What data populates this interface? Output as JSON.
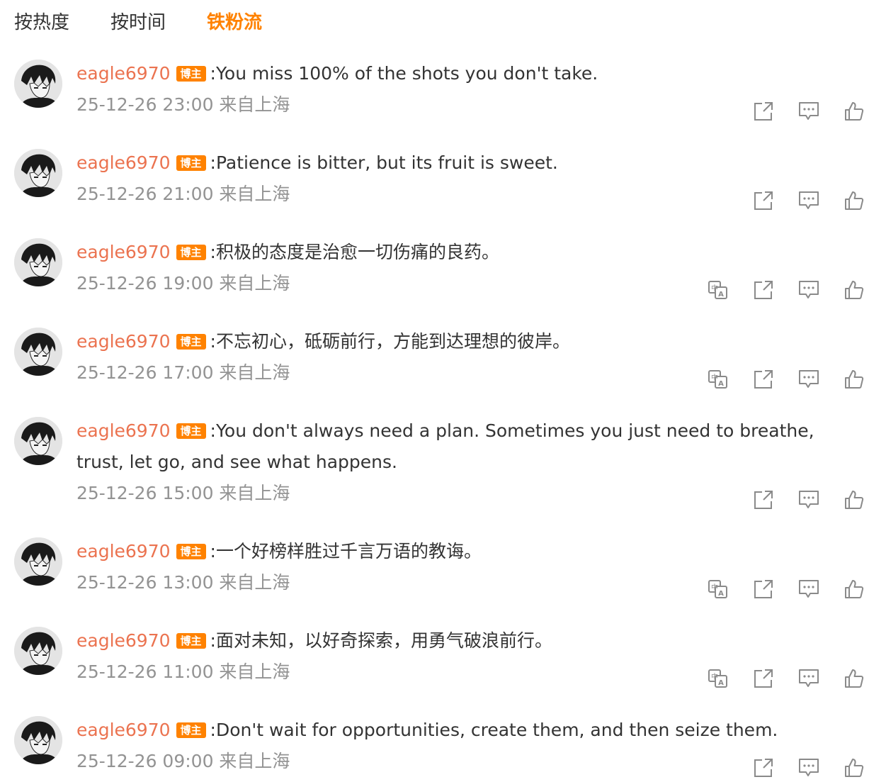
{
  "tabs": [
    {
      "label": "按热度",
      "active": false
    },
    {
      "label": "按时间",
      "active": false
    },
    {
      "label": "铁粉流",
      "active": true
    }
  ],
  "badge_label": "博主",
  "icons": {
    "translate": "translate-icon",
    "repost": "repost-icon",
    "comment": "comment-icon",
    "like": "like-icon"
  },
  "accent_color": "#ff8200",
  "name_color": "#eb7350",
  "comments": [
    {
      "user": "eagle6970",
      "text": ":You miss 100% of the shots you don't take.",
      "time": "25-12-26 23:00 来自上海",
      "translate": false
    },
    {
      "user": "eagle6970",
      "text": ":Patience is bitter, but its fruit is sweet.",
      "time": "25-12-26 21:00 来自上海",
      "translate": false
    },
    {
      "user": "eagle6970",
      "text": ":积极的态度是治愈一切伤痛的良药。",
      "time": "25-12-26 19:00 来自上海",
      "translate": true
    },
    {
      "user": "eagle6970",
      "text": ":不忘初心，砥砺前行，方能到达理想的彼岸。",
      "time": "25-12-26 17:00 来自上海",
      "translate": true
    },
    {
      "user": "eagle6970",
      "text": ":You don't always need a plan. Sometimes you just need to breathe, trust, let go, and see what happens.",
      "time": "25-12-26 15:00 来自上海",
      "translate": false
    },
    {
      "user": "eagle6970",
      "text": ":一个好榜样胜过千言万语的教诲。",
      "time": "25-12-26 13:00 来自上海",
      "translate": true
    },
    {
      "user": "eagle6970",
      "text": ":面对未知，以好奇探索，用勇气破浪前行。",
      "time": "25-12-26 11:00 来自上海",
      "translate": true
    },
    {
      "user": "eagle6970",
      "text": ":Don't wait for opportunities, create them, and then seize them.",
      "time": "25-12-26 09:00 来自上海",
      "translate": false
    }
  ]
}
